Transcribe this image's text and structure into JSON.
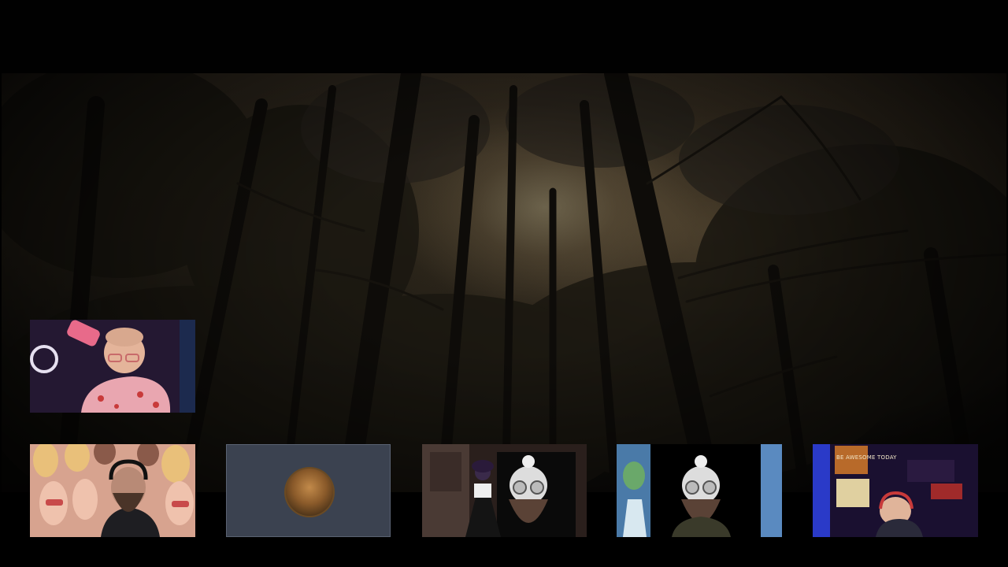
{
  "stream": {
    "scene": "forest-canopy-view"
  },
  "participants": [
    {
      "slot": "top-left",
      "label": "host-webcam"
    },
    {
      "slot": "bottom-1",
      "label": "bearded-streamer-webcam"
    },
    {
      "slot": "bottom-2",
      "label": "avatar-only-tile"
    },
    {
      "slot": "bottom-3",
      "label": "vtuber-duo-webcam"
    },
    {
      "slot": "bottom-4",
      "label": "masked-avatar-tile"
    },
    {
      "slot": "bottom-5",
      "label": "streamer-room-webcam"
    }
  ],
  "cam5": {
    "sign_text": "BE AWESOME TODAY"
  },
  "colors": {
    "background": "#000000",
    "avatar_tile_bg": "#3b4250"
  }
}
